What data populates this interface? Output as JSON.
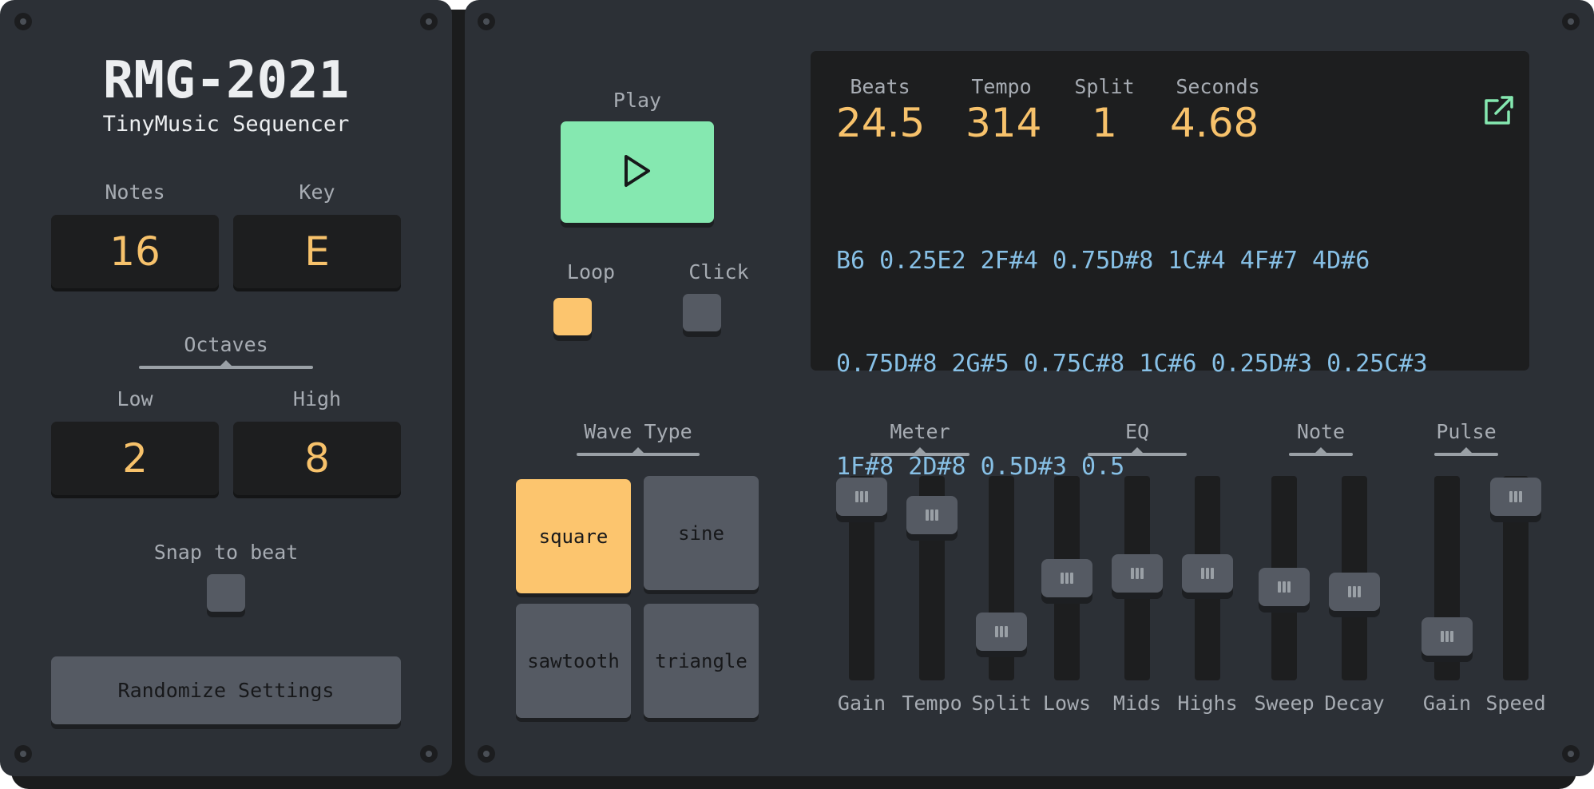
{
  "app": {
    "title": "RMG-2021",
    "subtitle": "TinyMusic Sequencer"
  },
  "settings": {
    "notes_label": "Notes",
    "notes_value": "16",
    "key_label": "Key",
    "key_value": "E",
    "octaves_label": "Octaves",
    "low_label": "Low",
    "low_value": "2",
    "high_label": "High",
    "high_value": "8",
    "snap_label": "Snap to beat",
    "snap_on": false,
    "randomize_label": "Randomize Settings"
  },
  "transport": {
    "play_label": "Play",
    "loop_label": "Loop",
    "loop_on": true,
    "click_label": "Click",
    "click_on": false
  },
  "display": {
    "stats": [
      {
        "label": "Beats",
        "value": "24.5"
      },
      {
        "label": "Tempo",
        "value": "314"
      },
      {
        "label": "Split",
        "value": "1"
      },
      {
        "label": "Seconds",
        "value": "4.68"
      }
    ],
    "sequence_lines": [
      "B6 0.25E2 2F#4 0.75D#8 1C#4 4F#7 4D#6",
      "0.75D#8 2G#5 0.75C#8 1C#6 0.25D#3 0.25C#3",
      "1F#8 2D#8 0.5D#3 0.5"
    ]
  },
  "wave_type": {
    "label": "Wave Type",
    "options": [
      "square",
      "sine",
      "sawtooth",
      "triangle"
    ],
    "selected": "square"
  },
  "slider_groups": {
    "meter": "Meter",
    "eq": "EQ",
    "note": "Note",
    "pulse": "Pulse"
  },
  "sliders": [
    {
      "label": "Gain",
      "level": 1.0
    },
    {
      "label": "Tempo",
      "level": 0.88
    },
    {
      "label": "Split",
      "level": 0.12
    },
    {
      "label": "Lows",
      "level": 0.47
    },
    {
      "label": "Mids",
      "level": 0.5
    },
    {
      "label": "Highs",
      "level": 0.5
    },
    {
      "label": "Sweep",
      "level": 0.41
    },
    {
      "label": "Decay",
      "level": 0.38
    },
    {
      "label": "Gain",
      "level": 0.09
    },
    {
      "label": "Speed",
      "level": 1.0
    }
  ],
  "colors": {
    "accent_yellow": "#fcc56e",
    "play_green": "#85e8b0",
    "sequence_blue": "#87c0e6",
    "panel": "#2c3036",
    "display_bg": "#1d1e1f"
  },
  "icons": {
    "play": "play-triangle-icon",
    "external_link": "external-link-icon",
    "screw": "screw-icon"
  }
}
